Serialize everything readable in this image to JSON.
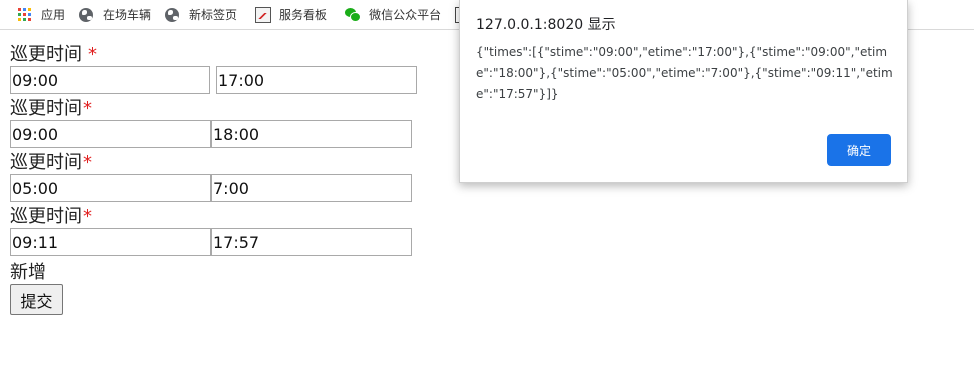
{
  "bookmarks": {
    "items": [
      {
        "label": "应用",
        "icon": "apps-grid-icon"
      },
      {
        "label": "在场车辆",
        "icon": "globe-icon"
      },
      {
        "label": "新标签页",
        "icon": "globe-icon"
      },
      {
        "label": "服务看板",
        "icon": "board-icon"
      },
      {
        "label": "微信公众平台",
        "icon": "wechat-icon"
      }
    ],
    "apps_colors": [
      "#ea4335",
      "#4285f4",
      "#fbbc05",
      "#34a853",
      "#ea4335",
      "#4285f4",
      "#fbbc05",
      "#34a853",
      "#ea4335"
    ]
  },
  "form": {
    "groups": [
      {
        "label": "巡更时间",
        "required_mark": "*",
        "start": "09:00",
        "end": "17:00"
      },
      {
        "label": "巡更时间",
        "required_mark": "*",
        "start": "09:00",
        "end": "18:00"
      },
      {
        "label": "巡更时间",
        "required_mark": "*",
        "start": "05:00",
        "end": "7:00"
      },
      {
        "label": "巡更时间",
        "required_mark": "*",
        "start": "09:11",
        "end": "17:57"
      }
    ],
    "add_label": "新增",
    "submit_label": "提交",
    "required_color": "#e02020"
  },
  "dialog": {
    "origin": "127.0.0.1:8020 显示",
    "message": "{\"times\":[{\"stime\":\"09:00\",\"etime\":\"17:00\"},{\"stime\":\"09:00\",\"etime\":\"18:00\"},{\"stime\":\"05:00\",\"etime\":\"7:00\"},{\"stime\":\"09:11\",\"etime\":\"17:57\"}]}",
    "ok_label": "确定",
    "ok_color": "#1a73e8"
  }
}
